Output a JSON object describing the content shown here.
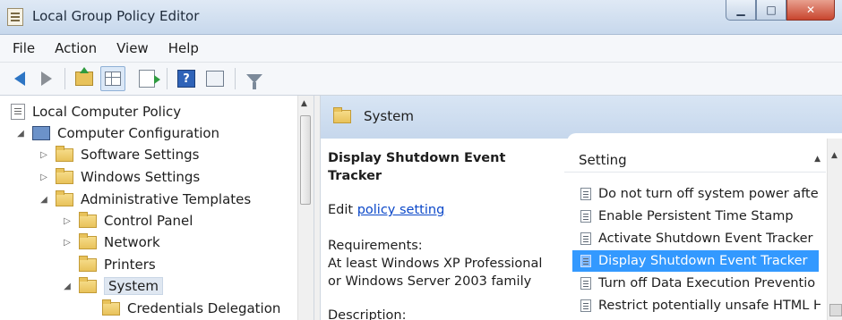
{
  "window": {
    "title": "Local Group Policy Editor",
    "minimize_glyph": "▁",
    "maximize_glyph": "□",
    "close_glyph": "✕"
  },
  "menu": [
    "File",
    "Action",
    "View",
    "Help"
  ],
  "toolbar": {
    "icons": [
      "back-arrow-icon",
      "forward-arrow-icon",
      "up-folder-icon",
      "show-hide-tree-icon",
      "export-list-icon",
      "help-icon",
      "properties-icon",
      "filter-icon"
    ],
    "help_glyph": "?"
  },
  "tree": {
    "root": "Local Computer Policy",
    "computer_configuration": "Computer Configuration",
    "software_settings": "Software Settings",
    "windows_settings": "Windows Settings",
    "administrative_templates": "Administrative Templates",
    "control_panel": "Control Panel",
    "network": "Network",
    "printers": "Printers",
    "system": "System",
    "credentials_delegation": "Credentials Delegation",
    "expanded_glyph": "◢",
    "collapsed_glyph": "▷"
  },
  "right_pane": {
    "header_title": "System",
    "description": {
      "heading": "Display Shutdown Event Tracker",
      "edit_prefix": "Edit ",
      "edit_link": "policy setting",
      "requirements_label": "Requirements:",
      "requirements_text": "At least Windows XP Professional or Windows Server 2003 family",
      "description_label": "Description:"
    },
    "list": {
      "column_header": "Setting",
      "items": [
        "Do not turn off system power afte",
        "Enable Persistent Time Stamp",
        "Activate Shutdown Event Tracker",
        "Display Shutdown Event Tracker",
        "Turn off Data Execution Preventio",
        "Restrict potentially unsafe HTML H"
      ],
      "selected_index": 3
    }
  },
  "colors": {
    "selection": "#3399ff",
    "link": "#0b48c9",
    "header_band": "#c6d7ec"
  }
}
